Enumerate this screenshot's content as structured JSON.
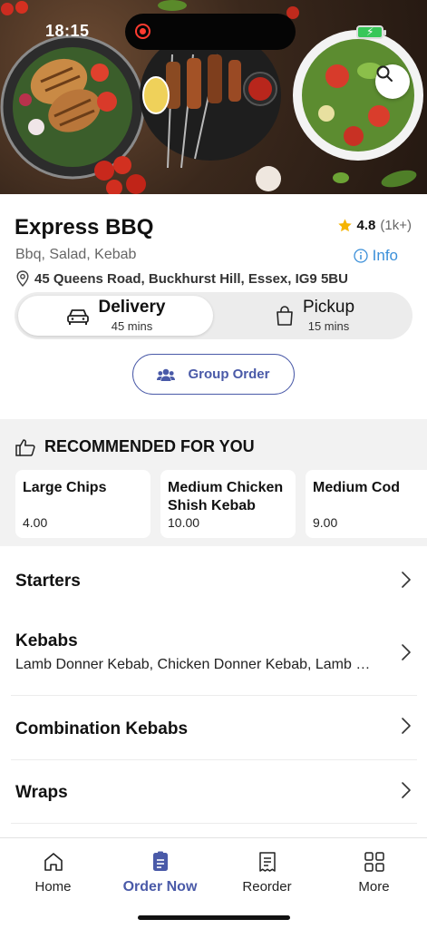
{
  "status_bar": {
    "time": "18:15",
    "battery_icon": "battery-charging-icon",
    "record_icon": "screen-record-icon"
  },
  "hero": {
    "search_icon": "search-icon"
  },
  "restaurant": {
    "name": "Express BBQ",
    "rating": "4.8",
    "rating_count": "(1k+)",
    "cuisines": "Bbq, Salad, Kebab",
    "info_label": "Info",
    "address": "45 Queens Road, Buckhurst Hill, Essex, IG9 5BU"
  },
  "order_mode": {
    "delivery": {
      "label": "Delivery",
      "time": "45 mins",
      "icon": "car-icon",
      "selected": true
    },
    "pickup": {
      "label": "Pickup",
      "time": "15 mins",
      "icon": "bag-icon",
      "selected": false
    }
  },
  "group_order": {
    "label": "Group Order",
    "icon": "group-icon"
  },
  "recommended": {
    "title": "RECOMMENDED FOR YOU",
    "items": [
      {
        "name": "Large Chips",
        "price": "4.00"
      },
      {
        "name": "Medium Chicken Shish Kebab",
        "price": "10.00"
      },
      {
        "name": "Medium Cod",
        "price": "9.00"
      }
    ]
  },
  "categories": [
    {
      "name": "Starters",
      "description": ""
    },
    {
      "name": "Kebabs",
      "description": "Lamb Donner Kebab, Chicken Donner Kebab, Lamb Sh..."
    },
    {
      "name": "Combination Kebabs",
      "description": ""
    },
    {
      "name": "Wraps",
      "description": ""
    }
  ],
  "tabbar": {
    "items": [
      {
        "label": "Home",
        "icon": "home-icon"
      },
      {
        "label": "Order Now",
        "icon": "order-icon",
        "active": true
      },
      {
        "label": "Reorder",
        "icon": "receipt-icon"
      },
      {
        "label": "More",
        "icon": "grid-icon"
      }
    ]
  },
  "colors": {
    "accent": "#4a5aa8",
    "info": "#3b8fd9",
    "star": "#f5b400"
  }
}
